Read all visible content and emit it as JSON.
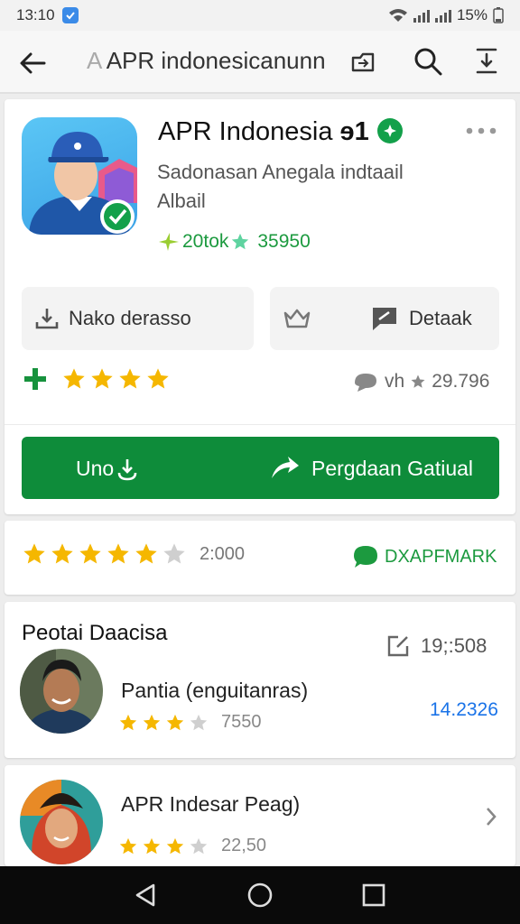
{
  "status": {
    "time": "13:10",
    "battery": "15%"
  },
  "app_bar": {
    "prefix": "A",
    "title": "APR indonesicanunn"
  },
  "app": {
    "name": "APR Indonesia",
    "name_suffix": "ɘ1",
    "developer": "Sadonasan Anegala indtaail Albail",
    "stats_left": "20tok",
    "stats_right": "35950"
  },
  "chips": {
    "left_label": "Nako derasso",
    "right_label": "Detaak"
  },
  "rating": {
    "stars": 4,
    "reviews_prefix": "vh",
    "reviews_count": "29.796"
  },
  "install": {
    "left_label": "Uno",
    "right_label": "Pergdaan Gatiual"
  },
  "rating_summary": {
    "stars": 5,
    "count": "2:000",
    "link": "DXAPFMARK"
  },
  "section": {
    "title": "Peotai Daacisa",
    "count": "19;:508",
    "items": [
      {
        "name": "Pantia (enguitanras)",
        "stars": 3,
        "value": "7550",
        "right": "14.2326"
      },
      {
        "name": "APR Indesar Peag)",
        "stars": 3,
        "value": "22,50"
      }
    ]
  },
  "colors": {
    "accent": "#0e8c3a",
    "star": "#f5b700",
    "link": "#1a73e8",
    "text_green": "#1c9a3f"
  }
}
